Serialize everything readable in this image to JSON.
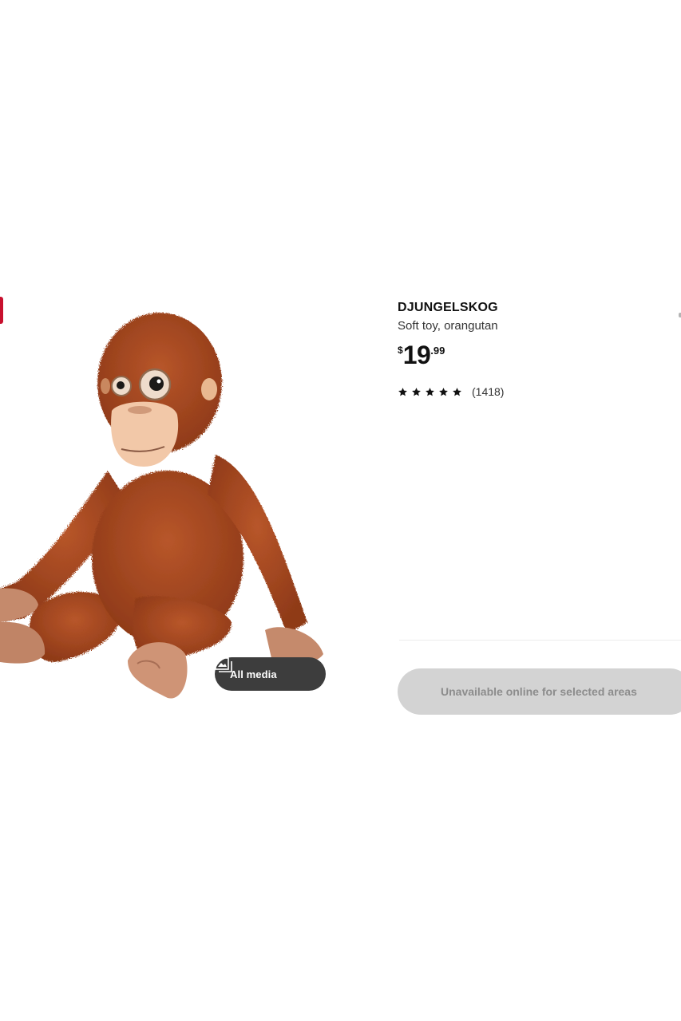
{
  "product": {
    "name": "DJUNGELSKOG",
    "description": "Soft toy, orangutan",
    "price": {
      "currency": "$",
      "integer": "19",
      "decimals": ".99"
    },
    "rating": {
      "stars": 5,
      "review_count": "(1418)"
    },
    "image_alt": "Orangutan soft toy"
  },
  "media": {
    "all_media_label": "All media",
    "icon": "gallery-icon"
  },
  "availability": {
    "label": "Unavailable online for selected areas",
    "enabled": false
  },
  "colors": {
    "price_text": "#111111",
    "media_button_bg": "#3d3d3d",
    "availability_bg": "#d3d3d3",
    "availability_text": "#8c8c8c",
    "fur": "#a8481f",
    "face": "#f2c8a8"
  }
}
